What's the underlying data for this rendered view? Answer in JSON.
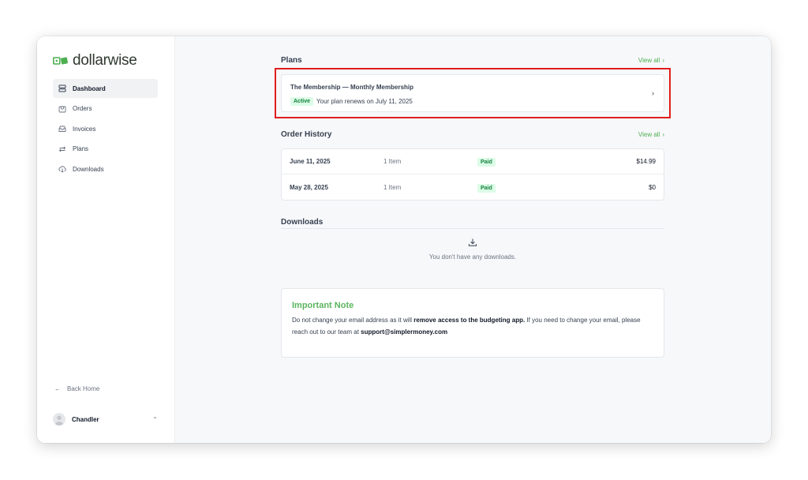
{
  "brand": {
    "name_prefix": "dollar",
    "name_suffix": "wise",
    "accent_color": "#4caf50"
  },
  "sidebar": {
    "items": [
      {
        "label": "Dashboard",
        "icon": "dashboard-icon",
        "active": true
      },
      {
        "label": "Orders",
        "icon": "orders-icon",
        "active": false
      },
      {
        "label": "Invoices",
        "icon": "invoices-icon",
        "active": false
      },
      {
        "label": "Plans",
        "icon": "plans-icon",
        "active": false
      },
      {
        "label": "Downloads",
        "icon": "downloads-icon",
        "active": false
      }
    ],
    "back_home": "Back Home",
    "user_name": "Chandler"
  },
  "plans": {
    "title": "Plans",
    "view_all": "View all",
    "plan_name": "The Membership — Monthly Membership",
    "status": "Active",
    "renewal": "Your plan renews on July 11, 2025"
  },
  "orders": {
    "title": "Order History",
    "view_all": "View all",
    "rows": [
      {
        "date": "June 11, 2025",
        "items": "1 Item",
        "status": "Paid",
        "amount": "$14.99"
      },
      {
        "date": "May 28, 2025",
        "items": "1 Item",
        "status": "Paid",
        "amount": "$0"
      }
    ]
  },
  "downloads": {
    "title": "Downloads",
    "empty": "You don't have any downloads."
  },
  "note": {
    "title": "Important Note",
    "text_1": "Do not change your email address as it will ",
    "text_bold_1": "remove access to the budgeting app.",
    "text_2": " If you need to change your email, please reach out to our team at ",
    "text_bold_2": "support@simplermoney.com"
  },
  "annotation": {
    "highlight_color": "#e11d1d"
  }
}
